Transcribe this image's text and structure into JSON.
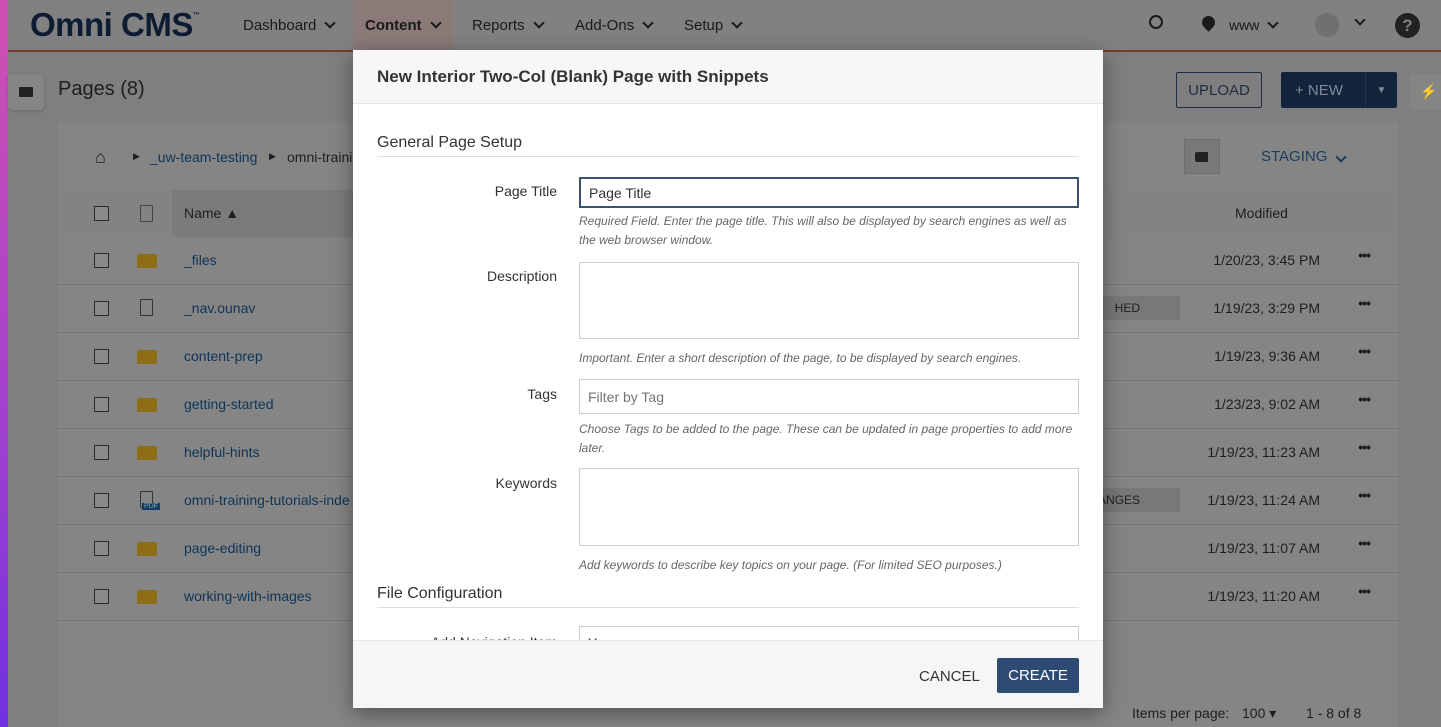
{
  "app": {
    "logo": "Omni CMS",
    "logo_tm": "™"
  },
  "nav": {
    "items": [
      {
        "label": "Dashboard"
      },
      {
        "label": "Content"
      },
      {
        "label": "Reports"
      },
      {
        "label": "Add-Ons"
      },
      {
        "label": "Setup"
      }
    ],
    "site": "www"
  },
  "page": {
    "title": "Pages (8)",
    "upload": "UPLOAD",
    "new": "+ NEW",
    "staging": "STAGING"
  },
  "breadcrumb": [
    "_uw-team-testing",
    "omni-traini"
  ],
  "table": {
    "headers": {
      "name": "Name ▲",
      "modified": "Modified"
    },
    "rows": [
      {
        "name": "_files",
        "type": "folder",
        "modified": "1/20/23, 3:45 PM",
        "status": ""
      },
      {
        "name": "_nav.ounav",
        "type": "file",
        "modified": "1/19/23, 3:29 PM",
        "status": "HED"
      },
      {
        "name": "content-prep",
        "type": "folder",
        "modified": "1/19/23, 9:36 AM",
        "status": ""
      },
      {
        "name": "getting-started",
        "type": "folder",
        "modified": "1/23/23, 9:02 AM",
        "status": ""
      },
      {
        "name": "helpful-hints",
        "type": "folder",
        "modified": "1/19/23, 11:23 AM",
        "status": ""
      },
      {
        "name": "omni-training-tutorials-inde",
        "type": "pdf",
        "modified": "1/19/23, 11:24 AM",
        "status": "HANGES"
      },
      {
        "name": "page-editing",
        "type": "folder",
        "modified": "1/19/23, 11:07 AM",
        "status": ""
      },
      {
        "name": "working-with-images",
        "type": "folder",
        "modified": "1/19/23, 11:20 AM",
        "status": ""
      }
    ],
    "pdf_label": "PDF"
  },
  "pagination": {
    "label": "Items per page:",
    "per_page": "100 ▾",
    "range": "1 - 8 of 8"
  },
  "modal": {
    "title": "New Interior Two-Col (Blank) Page with Snippets",
    "section1": "General Page Setup",
    "page_title_label": "Page Title",
    "page_title_value": "Page Title",
    "page_title_help": "Required Field. Enter the page title. This will also be displayed by search engines as well as the web browser window.",
    "description_label": "Description",
    "description_help": "Important. Enter a short description of the page, to be displayed by search engines.",
    "tags_label": "Tags",
    "tags_placeholder": "Filter by Tag",
    "tags_help": "Choose Tags to be added to the page. These can be updated in page properties to add more later.",
    "keywords_label": "Keywords",
    "keywords_help": "Add keywords to describe key topics on your page. (For limited SEO purposes.)",
    "section2": "File Configuration",
    "nav_item_label": "Add Navigation Item",
    "nav_item_value": "Yes",
    "cancel": "CANCEL",
    "create": "CREATE"
  }
}
